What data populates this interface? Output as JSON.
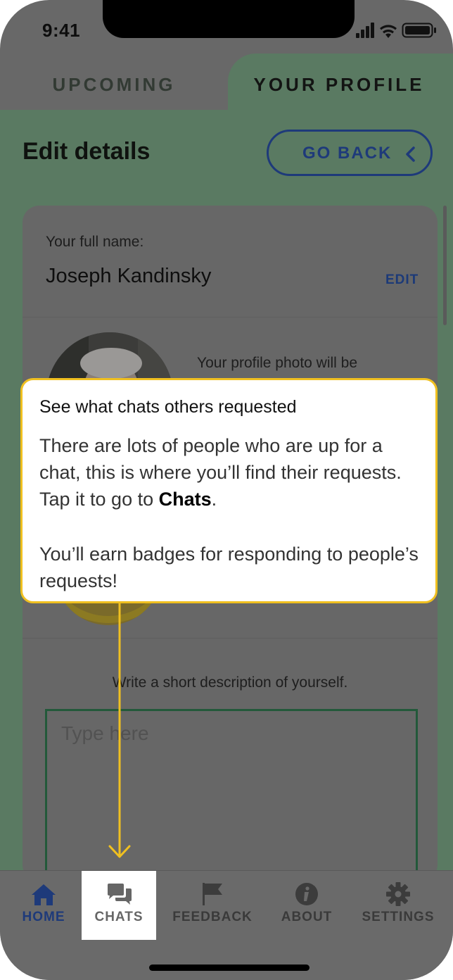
{
  "status": {
    "time": "9:41"
  },
  "tabs": {
    "upcoming": "UPCOMING",
    "profile": "YOUR PROFILE"
  },
  "header": {
    "title": "Edit details",
    "back_label": "GO BACK"
  },
  "profile": {
    "name_label": "Your full name:",
    "name_value": "Joseph Kandinsky",
    "edit_label": "EDIT",
    "photo_note": "Your profile photo will be",
    "description_label": "Write a short description of yourself.",
    "description_placeholder": "Type here"
  },
  "tooltip": {
    "title": "See what chats others requested",
    "body_before": "There are lots of people who are up for a chat, this is where you’ll find their requests. Tap it to go to ",
    "body_bold": "Chats",
    "body_after": ".",
    "body2": "You’ll earn badges for responding to people’s requests!"
  },
  "tabbar": {
    "items": [
      {
        "label": "HOME",
        "icon": "home-icon"
      },
      {
        "label": "CHATS",
        "icon": "chats-icon"
      },
      {
        "label": "FEEDBACK",
        "icon": "flag-icon"
      },
      {
        "label": "ABOUT",
        "icon": "info-icon"
      },
      {
        "label": "SETTINGS",
        "icon": "gear-icon"
      }
    ]
  },
  "colors": {
    "accent_blue": "#1e3a7a",
    "tooltip_border": "#f0c020",
    "profile_green": "#5a7a62",
    "overlay": "#686868"
  }
}
